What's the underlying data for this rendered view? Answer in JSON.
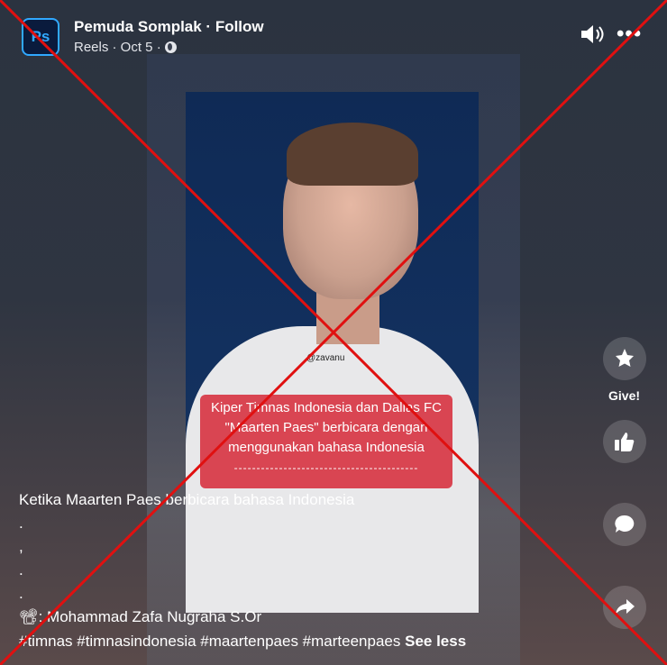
{
  "header": {
    "page_name": "Pemuda Somplak",
    "follow_label": "Follow",
    "name_line": "Pemuda Somplak · Follow",
    "meta": "Reels · Oct 5 ·",
    "avatar_text": "Ps",
    "sound_icon": "speaker-icon",
    "more_label": "•••"
  },
  "video": {
    "watermark": "@zavanu",
    "caption_lines": [
      "Kiper Timnas Indonesia dan Dallas FC",
      "\"Maarten Paes\" berbicara dengan",
      "menggunakan bahasa Indonesia",
      "-----------------------------------------"
    ],
    "corner_tag": "zavanu"
  },
  "actions": {
    "give_label": "Give!",
    "icons": [
      "star-gift-icon",
      "like-icon",
      "comment-icon",
      "share-icon"
    ]
  },
  "description": {
    "title": "Ketika Maarten Paes berbicara bahasa Indonesia",
    "dots": [
      ".",
      ",",
      ".",
      "."
    ],
    "credit": "📽: Mohammad Zafa Nugraha S.Or",
    "hashtags": "#timnas #timnasindonesia #maartenpaes #marteenpaes",
    "see_less": "See less"
  },
  "colors": {
    "cross": "#e01010",
    "caption_bg": "#d62d3c",
    "accent_ps": "#31a8ff"
  }
}
